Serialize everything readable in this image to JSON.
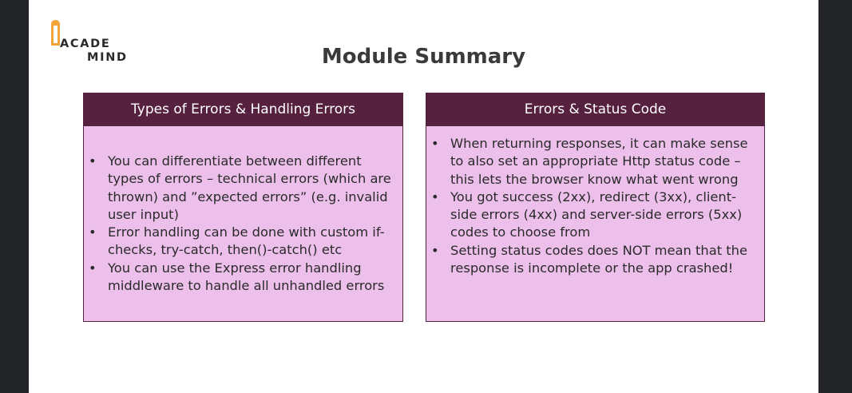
{
  "logo": {
    "line1": "ACADE",
    "line2": "MIND"
  },
  "title": "Module Summary",
  "cards": [
    {
      "heading": "Types of Errors & Handling Errors",
      "items": [
        "You can differentiate between different types of errors – technical errors (which are thrown) and ”expected errors” (e.g. invalid user input)",
        "Error handling can be done with custom if-checks, try-catch, then()-catch() etc",
        "You can use the Express error handling middleware to handle all unhandled errors"
      ]
    },
    {
      "heading": "Errors & Status Code",
      "items": [
        "When returning responses, it can make sense to also set an appropriate Http status code – this lets the browser know what went wrong",
        "You got success (2xx), redirect (3xx), client-side errors (4xx) and server-side errors (5xx) codes to choose from",
        "Setting status codes does NOT mean that the response is incomplete or the app crashed!"
      ]
    }
  ],
  "bullet_char": "•",
  "colors": {
    "card_header": "#56203f",
    "card_body": "#edc0eb",
    "logo_accent": "#f2a33a"
  }
}
